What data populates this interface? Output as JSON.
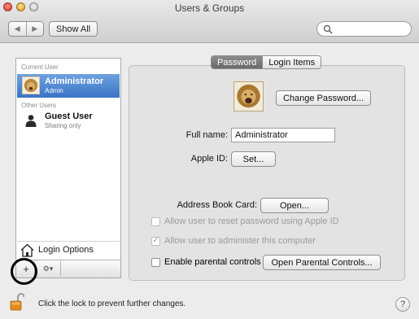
{
  "window": {
    "title": "Users & Groups"
  },
  "toolbar": {
    "back_label": "◀",
    "forward_label": "▶",
    "show_all_label": "Show All",
    "search_placeholder": ""
  },
  "sidebar": {
    "current_user_header": "Current User",
    "other_users_header": "Other Users",
    "users": [
      {
        "name": "Administrator",
        "sub": "Admin",
        "selected": true
      },
      {
        "name": "Guest User",
        "sub": "Sharing only",
        "selected": false
      }
    ],
    "login_options_label": "Login Options",
    "add_label": "+",
    "gear_label": "⚙▾"
  },
  "detail": {
    "tabs": [
      {
        "label": "Password",
        "active": true
      },
      {
        "label": "Login Items",
        "active": false
      }
    ],
    "change_password_label": "Change Password...",
    "full_name_label": "Full name:",
    "full_name_value": "Administrator",
    "apple_id_label": "Apple ID:",
    "apple_id_button": "Set...",
    "address_book_label": "Address Book Card:",
    "address_book_button": "Open...",
    "checks": [
      {
        "label": "Allow user to reset password using Apple ID",
        "checked": false,
        "disabled": true
      },
      {
        "label": "Allow user to administer this computer",
        "checked": true,
        "disabled": true
      },
      {
        "label": "Enable parental controls",
        "checked": false,
        "disabled": false
      }
    ],
    "parental_controls_button": "Open Parental Controls..."
  },
  "footer": {
    "lock_text": "Click the lock to prevent further changes.",
    "help_label": "?"
  },
  "colors": {
    "selection": "#3a73c6",
    "annotation": "#000000"
  }
}
